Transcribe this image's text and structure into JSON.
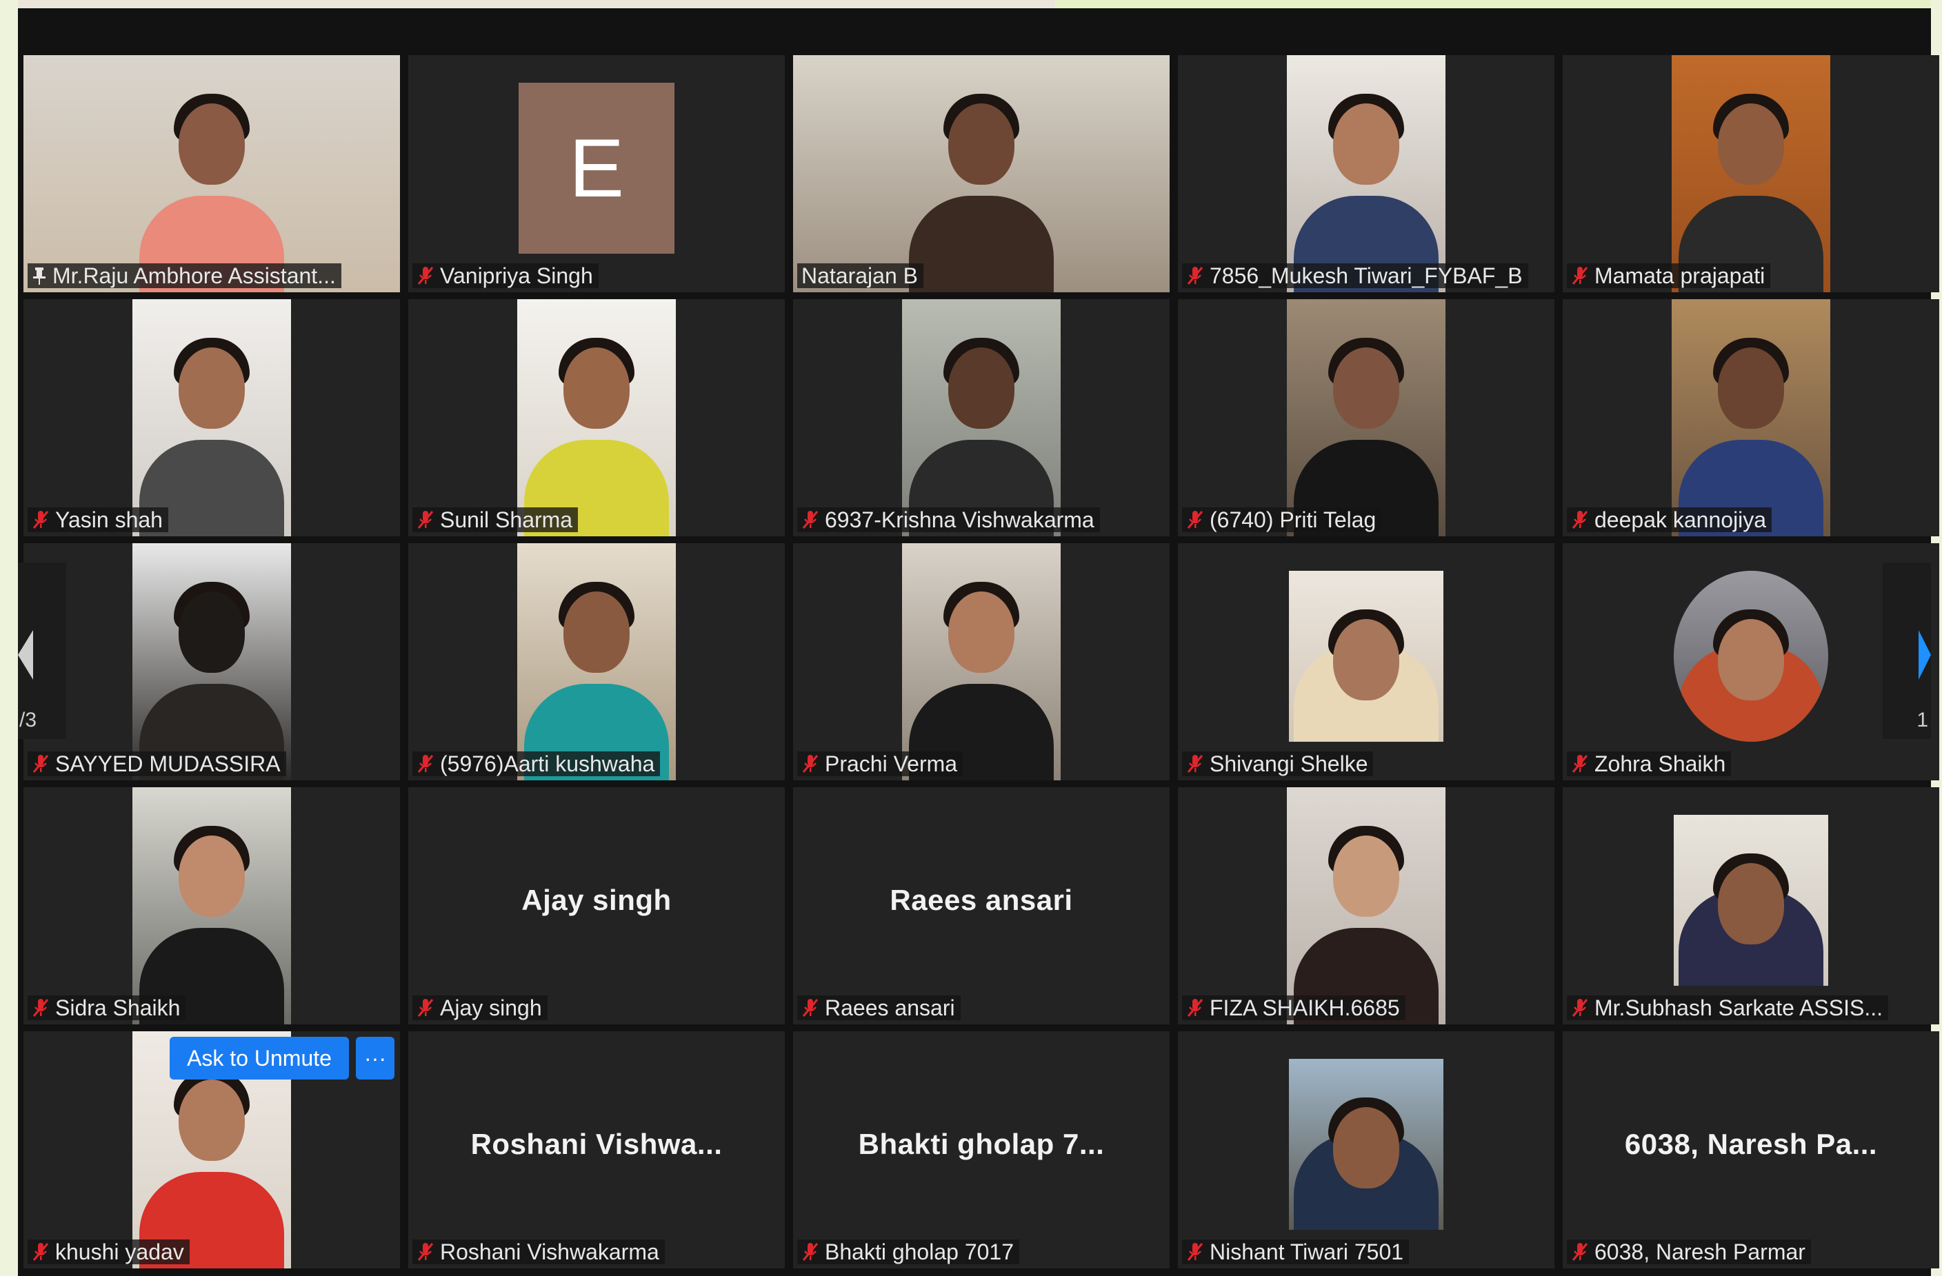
{
  "colors": {
    "active_speaker_border": "#c6e05a",
    "tile_bg": "#232323",
    "muted_icon": "#e0262c",
    "button_blue": "#1a7cf2"
  },
  "gallery": {
    "page_left_label": "/3",
    "page_right_label": "1",
    "participants": [
      {
        "name": "Mr.Raju Ambhore Assistant...",
        "icon": "pin-icon",
        "video": true,
        "active": false
      },
      {
        "name": "Vanipriya Singh",
        "icon": "mic-muted-icon",
        "video": false,
        "avatar_letter": "E"
      },
      {
        "name": "Natarajan B",
        "icon": "none",
        "video": true,
        "active": true
      },
      {
        "name": "7856_Mukesh Tiwari_FYBAF_B",
        "icon": "mic-muted-icon",
        "video": true
      },
      {
        "name": "Mamata prajapati",
        "icon": "mic-muted-icon",
        "video": true
      },
      {
        "name": "Yasin shah",
        "icon": "mic-muted-icon",
        "video": true
      },
      {
        "name": "Sunil Sharma",
        "icon": "mic-muted-icon",
        "video": true
      },
      {
        "name": "6937-Krishna Vishwakarma",
        "icon": "mic-muted-icon",
        "video": true
      },
      {
        "name": "(6740) Priti Telag",
        "icon": "mic-muted-icon",
        "video": true
      },
      {
        "name": "deepak kannojiya",
        "icon": "mic-muted-icon",
        "video": true
      },
      {
        "name": "SAYYED MUDASSIRA",
        "icon": "mic-muted-icon",
        "video": true
      },
      {
        "name": "(5976)Aarti kushwaha",
        "icon": "mic-muted-icon",
        "video": true
      },
      {
        "name": "Prachi Verma",
        "icon": "mic-muted-icon",
        "video": true
      },
      {
        "name": "Shivangi Shelke",
        "icon": "mic-muted-icon",
        "video": true
      },
      {
        "name": "Zohra Shaikh",
        "icon": "mic-muted-icon",
        "video": true
      },
      {
        "name": "Sidra Shaikh",
        "icon": "mic-muted-icon",
        "video": true
      },
      {
        "name": "Ajay singh",
        "icon": "mic-muted-icon",
        "video": false,
        "display_name": "Ajay singh"
      },
      {
        "name": "Raees ansari",
        "icon": "mic-muted-icon",
        "video": false,
        "display_name": "Raees ansari"
      },
      {
        "name": "FIZA SHAIKH.6685",
        "icon": "mic-muted-icon",
        "video": true
      },
      {
        "name": "Mr.Subhash Sarkate ASSIS...",
        "icon": "mic-muted-icon",
        "video": true
      },
      {
        "name": "khushi yadav",
        "icon": "mic-muted-icon",
        "video": true,
        "unmute_label": "Ask to Unmute",
        "more_label": "···"
      },
      {
        "name": "Roshani Vishwakarma",
        "icon": "mic-muted-icon",
        "video": false,
        "display_name": "Roshani  Vishwa..."
      },
      {
        "name": "Bhakti gholap 7017",
        "icon": "mic-muted-icon",
        "video": false,
        "display_name": "Bhakti  gholap  7..."
      },
      {
        "name": "Nishant Tiwari 7501",
        "icon": "mic-muted-icon",
        "video": true
      },
      {
        "name": "6038, Naresh Parmar",
        "icon": "mic-muted-icon",
        "video": false,
        "display_name": "6038,  Naresh  Pa..."
      }
    ]
  }
}
